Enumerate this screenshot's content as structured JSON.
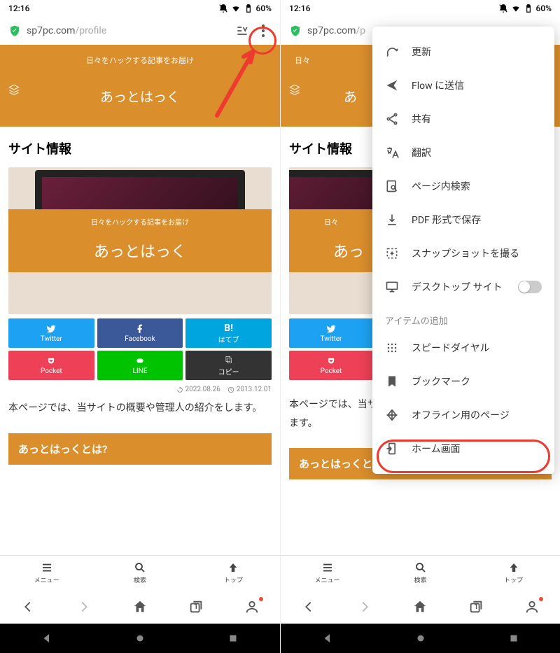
{
  "status": {
    "time": "12:16",
    "battery": "60%"
  },
  "url": {
    "host": "sp7pc.com",
    "path": "/profile",
    "path_cut": "/p"
  },
  "hero": {
    "tagline": "日々をハックする記事をお届け",
    "name": "あっとはっく"
  },
  "section": {
    "title": "サイト情報"
  },
  "share": {
    "twitter": "Twitter",
    "facebook": "Facebook",
    "hatebu": "はてブ",
    "pocket": "Pocket",
    "line": "LINE",
    "copy": "コピー"
  },
  "dates": {
    "updated": "2022.08.26",
    "published": "2013.12.01"
  },
  "intro": "本ページでは、当サイトの概要や管理人の紹介をします。",
  "intro_cut": "本ページでは、当サイトの概要や管理人の紹",
  "heading2": "あっとはっくとは?",
  "bottombar": {
    "menu": "メニュー",
    "search": "検索",
    "top": "トップ"
  },
  "menu": {
    "reload": "更新",
    "flow": "Flow に送信",
    "share": "共有",
    "translate": "翻訳",
    "find": "ページ内検索",
    "pdf": "PDF 形式で保存",
    "snapshot": "スナップショットを撮る",
    "desktop": "デスクトップ サイト",
    "section": "アイテムの追加",
    "speeddial": "スピードダイヤル",
    "bookmark": "ブックマーク",
    "offline": "オフライン用のページ",
    "home": "ホーム画面"
  }
}
